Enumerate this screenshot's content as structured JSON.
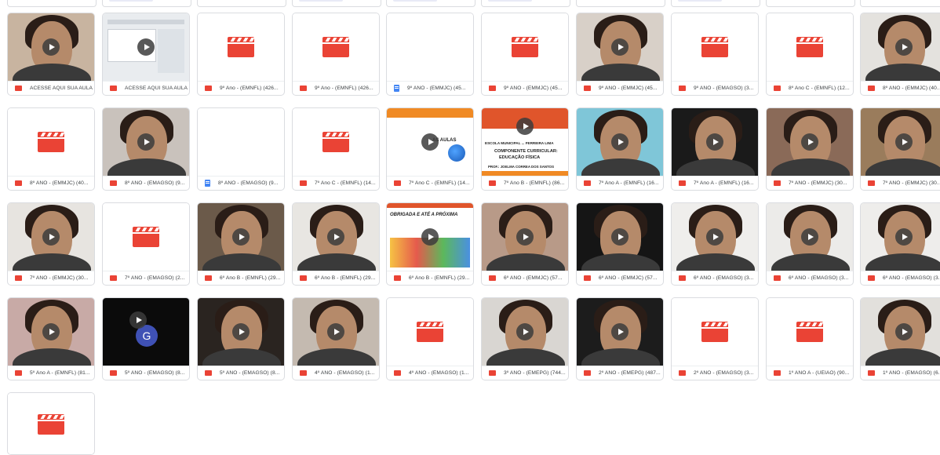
{
  "files": [
    {
      "name": "ACESSE AQUI SUA AULA",
      "type": "video",
      "thumb": "face",
      "tone": "#c8b4a0"
    },
    {
      "name": "ACESSE AQUI SUA AULA",
      "type": "video",
      "thumb": "doc",
      "tone": "#e9ecef"
    },
    {
      "name": "9º Ano - (EMNFL) (426...",
      "type": "video",
      "thumb": "clapper"
    },
    {
      "name": "9º Ano - (EMNFL) (426...",
      "type": "video",
      "thumb": "clapper"
    },
    {
      "name": "9º ANO - (EMMJC) (45...",
      "type": "doc",
      "thumb": "blank"
    },
    {
      "name": "9º ANO - (EMMJC) (45...",
      "type": "video",
      "thumb": "clapper"
    },
    {
      "name": "9º ANO - (EMMJC) (45...",
      "type": "video",
      "thumb": "face",
      "tone": "#d8d0c8"
    },
    {
      "name": "9º ANO - (EMAGSO) (3...",
      "type": "video",
      "thumb": "clapper"
    },
    {
      "name": "8º Ano C - (EMNFL) (12...",
      "type": "video",
      "thumb": "clapper"
    },
    {
      "name": "8º ANO - (EMMJC) (40...",
      "type": "video",
      "thumb": "face",
      "tone": "#e4e2de"
    },
    {
      "name": "8º ANO - (EMMJC) (40...",
      "type": "video",
      "thumb": "clapper"
    },
    {
      "name": "8º ANO - (EMAGSO) (9...",
      "type": "video",
      "thumb": "face",
      "tone": "#c9c2bc"
    },
    {
      "name": "8º ANO - (EMAGSO) (9...",
      "type": "doc",
      "thumb": "blank"
    },
    {
      "name": "7º Ano C - (EMNFL) (14...",
      "type": "video",
      "thumb": "clapper"
    },
    {
      "name": "7º Ano C - (EMNFL) (14...",
      "type": "video",
      "thumb": "slide",
      "tone": "#ffffff"
    },
    {
      "name": "7º Ano B - (EMNFL) (86...",
      "type": "video",
      "thumb": "slide2",
      "tone": "#ffffff"
    },
    {
      "name": "7º Ano A - (EMNFL) (16...",
      "type": "video",
      "thumb": "face",
      "tone": "#7fc6d8"
    },
    {
      "name": "7º Ano A - (EMNFL) (16...",
      "type": "video",
      "thumb": "face",
      "tone": "#1a1a1a"
    },
    {
      "name": "7º ANO - (EMMJC) (30...",
      "type": "video",
      "thumb": "face",
      "tone": "#8a6a58"
    },
    {
      "name": "7º ANO - (EMMJC) (30...",
      "type": "video",
      "thumb": "face",
      "tone": "#9a7c5c"
    },
    {
      "name": "7º ANO - (EMMJC) (30...",
      "type": "video",
      "thumb": "face",
      "tone": "#e7e4e0"
    },
    {
      "name": "7º ANO - (EMAGSO) (2...",
      "type": "video",
      "thumb": "clapper"
    },
    {
      "name": "6º Ano B - (EMNFL) (29...",
      "type": "video",
      "thumb": "face",
      "tone": "#6b5a4a"
    },
    {
      "name": "6º Ano B - (EMNFL) (29...",
      "type": "video",
      "thumb": "face",
      "tone": "#e8e6e2"
    },
    {
      "name": "6º Ano B - (EMNFL) (29...",
      "type": "video",
      "thumb": "slide3",
      "tone": "#ffffff"
    },
    {
      "name": "6º ANO - (EMMJC) (57...",
      "type": "video",
      "thumb": "face",
      "tone": "#b89a88"
    },
    {
      "name": "6º ANO - (EMMJC) (57...",
      "type": "video",
      "thumb": "face",
      "tone": "#151515"
    },
    {
      "name": "6º ANO - (EMAGSO) (3...",
      "type": "video",
      "thumb": "face",
      "tone": "#efeeec"
    },
    {
      "name": "6º ANO - (EMAGSO) (3...",
      "type": "video",
      "thumb": "face",
      "tone": "#ecebe9"
    },
    {
      "name": "6º ANO - (EMAGSO) (3...",
      "type": "video",
      "thumb": "face",
      "tone": "#eeedeb"
    },
    {
      "name": "5º Ano A - (EMNFL) (81...",
      "type": "video",
      "thumb": "face",
      "tone": "#c8aaa6"
    },
    {
      "name": "5º ANO - (EMAGSO) (8...",
      "type": "video",
      "thumb": "avatar",
      "tone": "#0b0b0b"
    },
    {
      "name": "5º ANO - (EMAGSO) (8...",
      "type": "video",
      "thumb": "face",
      "tone": "#2a2420"
    },
    {
      "name": "4º ANO - (EMAGSO) (1...",
      "type": "video",
      "thumb": "face",
      "tone": "#c4bab0"
    },
    {
      "name": "4º ANO - (EMAGSO) (1...",
      "type": "video",
      "thumb": "clapper"
    },
    {
      "name": "3º ANO - (EMEPG) (744...",
      "type": "video",
      "thumb": "face",
      "tone": "#d9d6d2"
    },
    {
      "name": "2º ANO - (EMEPG) (487...",
      "type": "video",
      "thumb": "face",
      "tone": "#1c1c1c"
    },
    {
      "name": "2º ANO - (EMAGSO) (3...",
      "type": "video",
      "thumb": "clapper"
    },
    {
      "name": "1º ANO A - (UEIAO) (90...",
      "type": "video",
      "thumb": "clapper"
    },
    {
      "name": "1º ANO - (EMAGSO) (6...",
      "type": "video",
      "thumb": "face",
      "tone": "#e2e0dc"
    },
    {
      "name": "",
      "type": "video",
      "thumb": "clapper",
      "partial": true
    }
  ],
  "slides": {
    "s1_line1": "AS AULAS",
    "s2_line1": "ESCOLA MUNICIPAL ... FERREIRA LIMA",
    "s2_line2": "COMPONENTE CURRICULAR:",
    "s2_line3": "EDUCAÇÃO FÍSICA",
    "s2_line4": "PROF.: JOELMA CORREA DOS SANTOS",
    "s3_line1": "OBRIGADA E ATÉ A PRÓXIMA"
  },
  "avatar_letter": "G",
  "colors": {
    "video_red": "#ea4335",
    "doc_blue": "#4285f4",
    "border": "#dadce0"
  }
}
